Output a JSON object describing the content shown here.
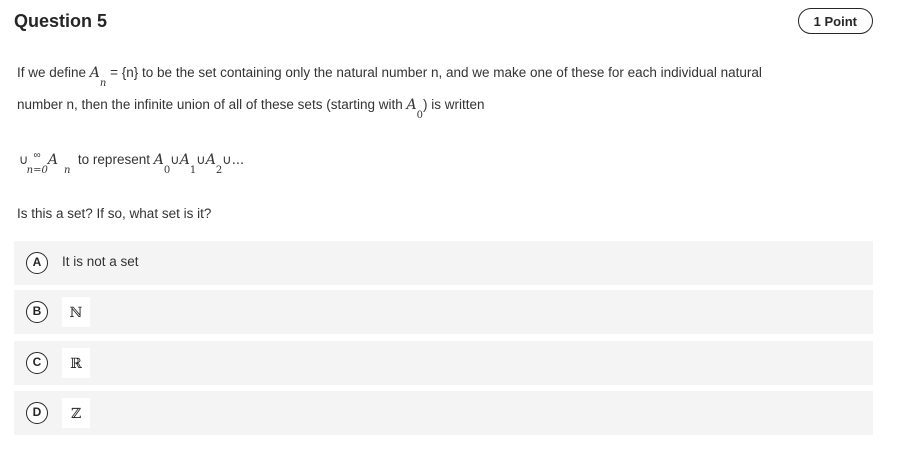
{
  "question": {
    "title": "Question 5",
    "points": "1 Point",
    "intro_part1": "If we define ",
    "A": "A",
    "n": "n",
    "intro_part2": " = {n} to be the set containing only the natural number n, and we make one of these for each individual natural",
    "line2_part1": "number n, then the infinite union of all of these sets (starting with ",
    "zero": "0",
    "line2_part2": ") is written",
    "union_symbol": "∪",
    "infinity": "∞",
    "n_eq_0": "n=0",
    "to_represent": "  to represent ",
    "one": "1",
    "two": "2",
    "ellipsis": "∪...",
    "prompt": "Is this a set? If so, what set is it?"
  },
  "options": [
    {
      "letter": "A",
      "text": "It is not a set"
    },
    {
      "letter": "B",
      "text": "ℕ"
    },
    {
      "letter": "C",
      "text": "ℝ"
    },
    {
      "letter": "D",
      "text": "ℤ"
    }
  ]
}
